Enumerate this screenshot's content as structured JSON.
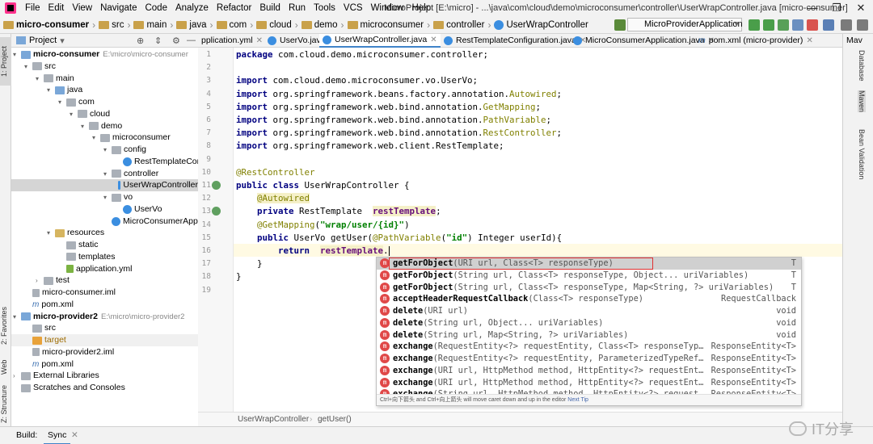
{
  "menubar": {
    "items": [
      "File",
      "Edit",
      "View",
      "Navigate",
      "Code",
      "Analyze",
      "Refactor",
      "Build",
      "Run",
      "Tools",
      "VCS",
      "Window",
      "Help"
    ],
    "title": "MicroProject [E:\\micro] - ...\\java\\com\\cloud\\demo\\microconsumer\\controller\\UserWrapController.java [micro-consumer]"
  },
  "navbar": {
    "crumbs": [
      "micro-consumer",
      "src",
      "main",
      "java",
      "com",
      "cloud",
      "demo",
      "microconsumer",
      "controller",
      "UserWrapController"
    ],
    "run_config": "MicroProviderApplication"
  },
  "project_panel": {
    "header": "Project",
    "tree": [
      {
        "label": "micro-consumer",
        "path": "E:\\micro\\micro-consumer",
        "depth": 0,
        "open": true,
        "kind": "module",
        "bold": true
      },
      {
        "label": "src",
        "depth": 1,
        "open": true,
        "kind": "folder"
      },
      {
        "label": "main",
        "depth": 2,
        "open": true,
        "kind": "folder"
      },
      {
        "label": "java",
        "depth": 3,
        "open": true,
        "kind": "src-folder"
      },
      {
        "label": "com",
        "depth": 4,
        "open": true,
        "kind": "folder"
      },
      {
        "label": "cloud",
        "depth": 5,
        "open": true,
        "kind": "folder"
      },
      {
        "label": "demo",
        "depth": 6,
        "open": true,
        "kind": "folder"
      },
      {
        "label": "microconsumer",
        "depth": 7,
        "open": true,
        "kind": "folder"
      },
      {
        "label": "config",
        "depth": 8,
        "open": true,
        "kind": "folder"
      },
      {
        "label": "RestTemplateConfigurat",
        "depth": 9,
        "kind": "class"
      },
      {
        "label": "controller",
        "depth": 8,
        "open": true,
        "kind": "folder"
      },
      {
        "label": "UserWrapController",
        "depth": 9,
        "kind": "class",
        "selected": true
      },
      {
        "label": "vo",
        "depth": 8,
        "open": true,
        "kind": "folder"
      },
      {
        "label": "UserVo",
        "depth": 9,
        "kind": "class"
      },
      {
        "label": "MicroConsumerApplication",
        "depth": 8,
        "kind": "class"
      },
      {
        "label": "resources",
        "depth": 3,
        "open": true,
        "kind": "res-folder"
      },
      {
        "label": "static",
        "depth": 4,
        "kind": "folder"
      },
      {
        "label": "templates",
        "depth": 4,
        "kind": "folder"
      },
      {
        "label": "application.yml",
        "depth": 4,
        "kind": "yml"
      },
      {
        "label": "test",
        "depth": 2,
        "open": false,
        "kind": "folder"
      },
      {
        "label": "micro-consumer.iml",
        "depth": 1,
        "kind": "iml"
      },
      {
        "label": "pom.xml",
        "depth": 1,
        "kind": "maven"
      },
      {
        "label": "micro-provider2",
        "path": "E:\\micro\\micro-provider2",
        "depth": 0,
        "open": true,
        "kind": "module",
        "bold": true
      },
      {
        "label": "src",
        "depth": 1,
        "kind": "folder"
      },
      {
        "label": "target",
        "depth": 1,
        "kind": "target",
        "selected_light": true
      },
      {
        "label": "micro-provider2.iml",
        "depth": 1,
        "kind": "iml"
      },
      {
        "label": "pom.xml",
        "depth": 1,
        "kind": "maven"
      },
      {
        "label": "External Libraries",
        "depth": 0,
        "open": false,
        "kind": "lib"
      },
      {
        "label": "Scratches and Consoles",
        "depth": 0,
        "kind": "scratch"
      }
    ]
  },
  "left_tool_tabs": [
    "1: Project",
    "2: Favorites",
    "Web",
    "Z: Structure"
  ],
  "right_tool_tabs": [
    "Database",
    "Maven",
    "Bean Validation"
  ],
  "editor_tabs": [
    {
      "label": "pplication.yml",
      "kind": "yml"
    },
    {
      "label": "UserVo.java",
      "kind": "class"
    },
    {
      "label": "UserWrapController.java",
      "kind": "class",
      "active": true
    },
    {
      "label": "RestTemplateConfiguration.java",
      "kind": "class"
    },
    {
      "label": "MicroConsumerApplication.java",
      "kind": "class"
    },
    {
      "label": "pom.xml (micro-provider)",
      "kind": "maven"
    }
  ],
  "right_panel_tab": "Mav",
  "code": {
    "line_numbers": [
      "1",
      "2",
      "3",
      "4",
      "5",
      "6",
      "7",
      "8",
      "9",
      "10",
      "11",
      "12",
      "13",
      "14",
      "15",
      "16",
      "17",
      "18",
      "19"
    ],
    "lines": [
      [
        [
          "kw",
          "package "
        ],
        [
          "",
          "com.cloud.demo.microconsumer.controller;"
        ]
      ],
      [],
      [
        [
          "kw",
          "import "
        ],
        [
          "",
          "com.cloud.demo.microconsumer.vo.UserVo;"
        ]
      ],
      [
        [
          "kw",
          "import "
        ],
        [
          "",
          "org.springframework.beans.factory.annotation."
        ],
        [
          "ann",
          "Autowired"
        ],
        [
          "",
          ";"
        ]
      ],
      [
        [
          "kw",
          "import "
        ],
        [
          "",
          "org.springframework.web.bind.annotation."
        ],
        [
          "ann",
          "GetMapping"
        ],
        [
          "",
          ";"
        ]
      ],
      [
        [
          "kw",
          "import "
        ],
        [
          "",
          "org.springframework.web.bind.annotation."
        ],
        [
          "ann",
          "PathVariable"
        ],
        [
          "",
          ";"
        ]
      ],
      [
        [
          "kw",
          "import "
        ],
        [
          "",
          "org.springframework.web.bind.annotation."
        ],
        [
          "ann",
          "RestController"
        ],
        [
          "",
          ";"
        ]
      ],
      [
        [
          "kw",
          "import "
        ],
        [
          "",
          "org.springframework.web.client.RestTemplate;"
        ]
      ],
      [],
      [
        [
          "ann",
          "@RestController"
        ]
      ],
      [
        [
          "kw",
          "public class "
        ],
        [
          "",
          "UserWrapController {"
        ]
      ],
      [
        [
          "",
          "    "
        ],
        [
          "ann hl",
          "@Autowired"
        ]
      ],
      [
        [
          "",
          "    "
        ],
        [
          "kw",
          "private "
        ],
        [
          "",
          "RestTemplate  "
        ],
        [
          "fld sh",
          "restTemplate"
        ],
        [
          "",
          ";"
        ]
      ],
      [
        [
          "",
          "    "
        ],
        [
          "ann",
          "@GetMapping"
        ],
        [
          "",
          "("
        ],
        [
          "str",
          "\"wrap/user/{id}\""
        ],
        [
          "",
          ")"
        ]
      ],
      [
        [
          "",
          "    "
        ],
        [
          "kw",
          "public "
        ],
        [
          "",
          "UserVo getUser("
        ],
        [
          "ann",
          "@PathVariable"
        ],
        [
          "",
          "("
        ],
        [
          "str",
          "\"id\""
        ],
        [
          "",
          ") Integer userId){"
        ]
      ],
      [
        [
          "",
          "        "
        ],
        [
          "kw",
          "return  "
        ],
        [
          "fld sh",
          "restTemplate"
        ],
        [
          "",
          "."
        ]
      ],
      [
        [
          "",
          "    }"
        ]
      ],
      [
        [
          "",
          "}"
        ]
      ],
      []
    ]
  },
  "completion": {
    "rows": [
      {
        "name": "getForObject",
        "sig": "(URI url, Class<T> responseType)",
        "ret": "T"
      },
      {
        "name": "getForObject",
        "sig": "(String url, Class<T> responseType, Object... uriVariables)",
        "ret": "T"
      },
      {
        "name": "getForObject",
        "sig": "(String url, Class<T> responseType, Map<String, ?> uriVariables)",
        "ret": "T"
      },
      {
        "name": "acceptHeaderRequestCallback",
        "sig": "(Class<T> responseType)",
        "ret": "RequestCallback"
      },
      {
        "name": "delete",
        "sig": "(URI url)",
        "ret": "void"
      },
      {
        "name": "delete",
        "sig": "(String url, Object... uriVariables)",
        "ret": "void"
      },
      {
        "name": "delete",
        "sig": "(String url, Map<String, ?> uriVariables)",
        "ret": "void"
      },
      {
        "name": "exchange",
        "sig": "(RequestEntity<?> requestEntity, Class<T> responseTyp…",
        "ret": "ResponseEntity<T>"
      },
      {
        "name": "exchange",
        "sig": "(RequestEntity<?> requestEntity, ParameterizedTypeRef…",
        "ret": "ResponseEntity<T>"
      },
      {
        "name": "exchange",
        "sig": "(URI url, HttpMethod method, HttpEntity<?> requestEnt…",
        "ret": "ResponseEntity<T>"
      },
      {
        "name": "exchange",
        "sig": "(URI url, HttpMethod method, HttpEntity<?> requestEnt…",
        "ret": "ResponseEntity<T>"
      },
      {
        "name": "exchange",
        "sig": "(String url, HttpMethod method, HttpEntity<?> request…",
        "ret": "ResponseEntity<T>"
      }
    ],
    "hint": "Ctrl+向下箭头 and Ctrl+向上箭头 will move caret down and up in the editor",
    "hint_link": "Next Tip"
  },
  "code_breadcrumb": [
    "UserWrapController",
    "getUser()"
  ],
  "statusbar": {
    "build": "Build:",
    "sync": "Sync"
  },
  "watermark": "IT分享"
}
